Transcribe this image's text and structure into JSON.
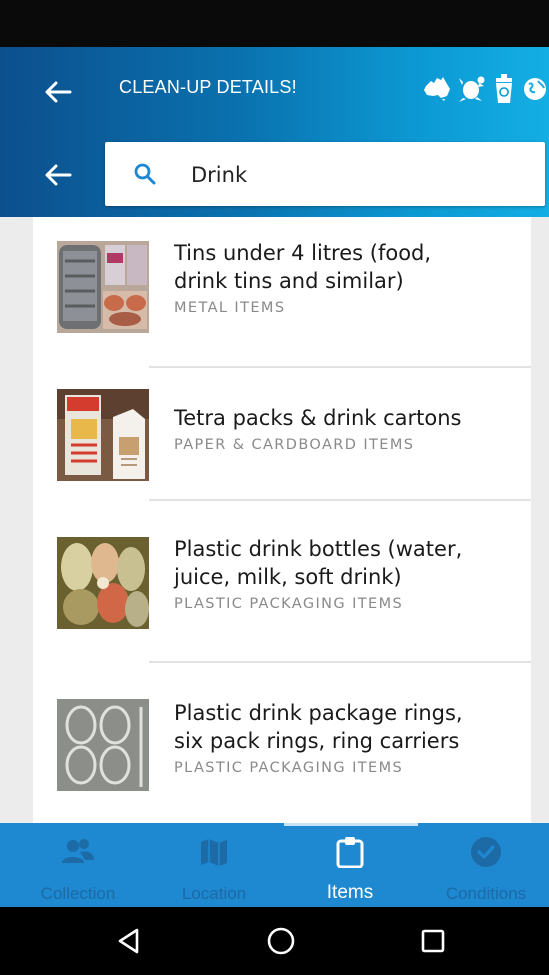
{
  "header": {
    "title": "CLEAN-UP DETAILS!",
    "brand_icons": [
      "australia-map-icon",
      "turtle-icon",
      "bin-icon",
      "globe-icon"
    ]
  },
  "search": {
    "value": "Drink"
  },
  "results": [
    {
      "title_line1": "Tins under 4 litres (food,",
      "title_line2": "drink tins and similar)",
      "category": "METAL ITEMS",
      "thumb": "tins-photo"
    },
    {
      "title_line1": "Tetra packs & drink cartons",
      "title_line2": "",
      "category": "PAPER & CARDBOARD ITEMS",
      "thumb": "cartons-photo"
    },
    {
      "title_line1": "Plastic drink bottles (water,",
      "title_line2": "juice, milk, soft drink)",
      "category": "PLASTIC PACKAGING ITEMS",
      "thumb": "bottles-photo"
    },
    {
      "title_line1": "Plastic drink package rings,",
      "title_line2": "six pack rings, ring carriers",
      "category": "PLASTIC PACKAGING ITEMS",
      "thumb": "rings-photo"
    }
  ],
  "bottom_nav": {
    "items": [
      {
        "label": "Collection",
        "icon": "people-icon",
        "active": false
      },
      {
        "label": "Location",
        "icon": "map-icon",
        "active": false
      },
      {
        "label": "Items",
        "icon": "clipboard-icon",
        "active": true
      },
      {
        "label": "Conditions",
        "icon": "check-circle-icon",
        "active": false
      }
    ]
  },
  "colors": {
    "header_start": "#0c4f8d",
    "header_end": "#13aee4",
    "bottom_nav": "#1e88d0",
    "inactive_nav": "#1c6aa6",
    "search_icon": "#1e88d0"
  }
}
